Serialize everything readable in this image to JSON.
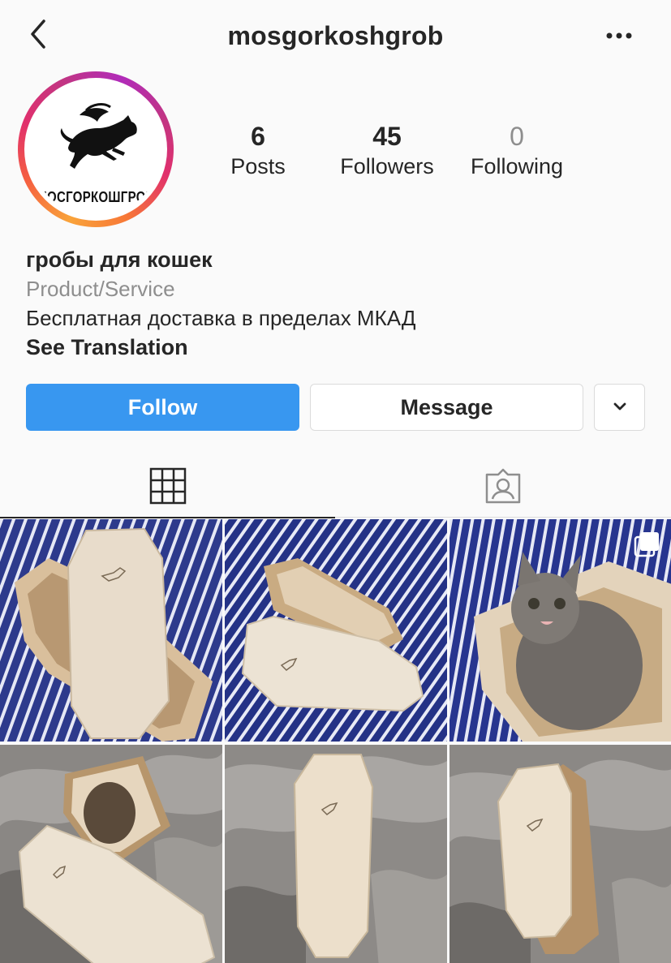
{
  "header": {
    "username": "mosgorkoshgrob",
    "back_icon": "chevron-left-icon",
    "more_icon": "more-horizontal-icon"
  },
  "profile": {
    "avatar_text": "МОСГОРКОШГРОБ",
    "stats": {
      "posts": {
        "value": "6",
        "label": "Posts"
      },
      "followers": {
        "value": "45",
        "label": "Followers"
      },
      "following": {
        "value": "0",
        "label": "Following"
      }
    },
    "name": "гробы для кошек",
    "category": "Product/Service",
    "bio": "Бесплатная доставка в пределах МКАД",
    "see_translation": "See Translation"
  },
  "actions": {
    "follow_label": "Follow",
    "message_label": "Message",
    "dropdown_icon": "chevron-down-icon"
  },
  "tabs": [
    {
      "name": "grid",
      "icon": "grid-icon",
      "active": true
    },
    {
      "name": "tagged",
      "icon": "tagged-user-icon",
      "active": false
    }
  ],
  "posts": [
    {
      "id": 1,
      "subject": "open coffin with lid on striped fabric",
      "multiple": false
    },
    {
      "id": 2,
      "subject": "coffin with lid leaning on striped fabric",
      "multiple": false
    },
    {
      "id": 3,
      "subject": "kitten sitting in coffin",
      "multiple": true
    },
    {
      "id": 4,
      "subject": "cat lying in coffin on grey tulle",
      "multiple": false
    },
    {
      "id": 5,
      "subject": "closed coffin on grey tulle",
      "multiple": false
    },
    {
      "id": 6,
      "subject": "coffin with lid on grey tulle",
      "multiple": false
    }
  ],
  "colors": {
    "follow_blue": "#3897f0",
    "text": "#262626",
    "muted": "#8e8e8e",
    "border": "#dbdbdb"
  }
}
